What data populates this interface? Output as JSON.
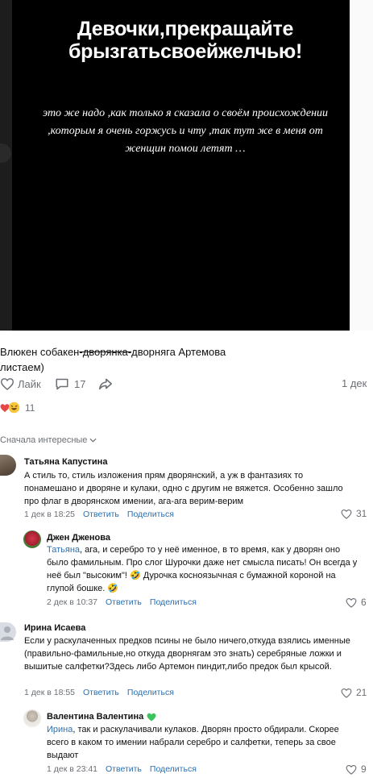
{
  "post": {
    "image_title_line1": "Девочки,прекращайте",
    "image_title_line2": "брызгатьсвоейжелчью!",
    "image_body": "это же надо ,как только я сказала о своём происхождении ,которым я очень горжусь и чту ,так тут же в меня от женщин помои летят …",
    "caption_part1": "Влюкен собакен",
    "caption_strike": "-дворянка-",
    "caption_part2": "дворняга Артемова",
    "caption_line2": "листаем)"
  },
  "actions": {
    "like_label": "Лайк",
    "comments_count": "17",
    "date": "1 дек"
  },
  "reactions": {
    "count": "11"
  },
  "sort": {
    "label": "Сначала интересные"
  },
  "comments": [
    {
      "name": "Татьяна Капустина",
      "text": "А стиль то, стиль изложения прям дворянский, а уж в фантазиях то понамешано и дворяне и кулаки, одно с другим не вяжется. Особенно зашло про флаг в дворянском имении, ага-ага верим-верим",
      "date": "1 дек в 18:25",
      "reply": "Ответить",
      "share": "Поделиться",
      "likes": "31"
    },
    {
      "name": "Джен Дженова",
      "mention": "Татьяна",
      "text": ", ага, и серебро то у неё именное, в то время, как у дворян оно было фамильным. Про слог Шурочки даже нет смысла писать! Он всегда у неё был \"высоким\"! 🤣 Дурочка косноязычная с бумажной короной на глупой бошке. 🤣",
      "date": "2 дек в 10:37",
      "reply": "Ответить",
      "share": "Поделиться",
      "likes": "6"
    },
    {
      "name": "Ирина Исаева",
      "text": "Если у раскулаченных предков псины не было ничего,откуда взялись именные (правильно-фамильные,но откуда дворнягам это знать) серебряные ложки и вышитые салфетки?Здесь либо Артемон пиндит,либо предок был крысой.",
      "date": "1 дек в 18:55",
      "reply": "Ответить",
      "share": "Поделиться",
      "likes": "21"
    },
    {
      "name": "Валентина Валентина",
      "mention": "Ирина",
      "text": ", так и раскулачивали кулаков. Дворян просто обдирали. Скорее всего в каком то имении набрали серебро и салфетки, теперь за свое выдают",
      "date": "1 дек в 23:41",
      "reply": "Ответить",
      "share": "Поделиться",
      "likes": "9"
    }
  ],
  "colors": {
    "accent": "#2b6fb2",
    "muted": "#6b6f76",
    "heart_red": "#e64646"
  }
}
